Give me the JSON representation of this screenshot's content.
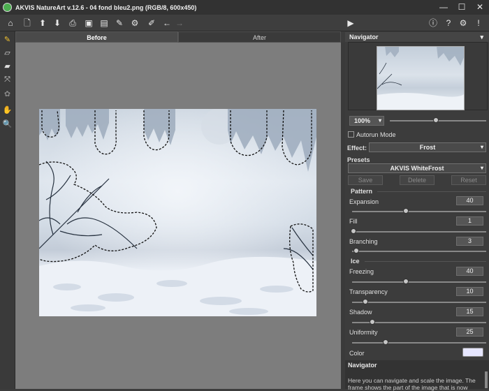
{
  "titlebar": {
    "title": "AKVIS NatureArt v.12.6 - 04 fond bleu2.png (RGB/8, 600x450)",
    "minimize_glyph": "—",
    "maximize_glyph": "☐",
    "close_glyph": "✕"
  },
  "toolbar": {
    "icons": [
      "home-icon",
      "new-file-icon",
      "open-file-icon",
      "save-file-icon",
      "print-icon",
      "batch-icon",
      "batch-settings-icon",
      "presets-icon",
      "settings-icon",
      "brush-tool-icon",
      "undo-icon",
      "redo-icon",
      "run-icon",
      "info-icon",
      "help-icon",
      "preferences-icon",
      "notifications-icon"
    ]
  },
  "tabs": {
    "before": "Before",
    "after": "After"
  },
  "navigator": {
    "title": "Navigator",
    "menu_glyph": "▾",
    "zoom": "100%"
  },
  "autorun": {
    "label": "Autorun Mode",
    "checked": false
  },
  "effect": {
    "label": "Effect:",
    "value": "Frost"
  },
  "presets": {
    "label": "Presets",
    "value": "AKVIS WhiteFrost",
    "save_label": "Save",
    "delete_label": "Delete",
    "reset_label": "Reset"
  },
  "pattern": {
    "title": "Pattern",
    "expansion": {
      "label": "Expansion",
      "value": "40",
      "fraction": 0.4
    },
    "fill": {
      "label": "Fill",
      "value": "1",
      "fraction": 0.01
    },
    "branching": {
      "label": "Branching",
      "value": "3",
      "fraction": 0.03
    }
  },
  "ice": {
    "title": "Ice",
    "freezing": {
      "label": "Freezing",
      "value": "40",
      "fraction": 0.4
    },
    "transparency": {
      "label": "Transparency",
      "value": "10",
      "fraction": 0.1
    },
    "shadow": {
      "label": "Shadow",
      "value": "15",
      "fraction": 0.15
    },
    "uniformity": {
      "label": "Uniformity",
      "value": "25",
      "fraction": 0.25
    }
  },
  "color": {
    "label": "Color",
    "value": "#e6e6ff"
  },
  "help": {
    "title": "Navigator",
    "text": "Here you can navigate and scale the image. The frame shows the part of the image that is now"
  },
  "colors": {
    "panel_bg": "#3c3c3c",
    "canvas_bg": "#7d7d7d",
    "selection": "#111111"
  }
}
